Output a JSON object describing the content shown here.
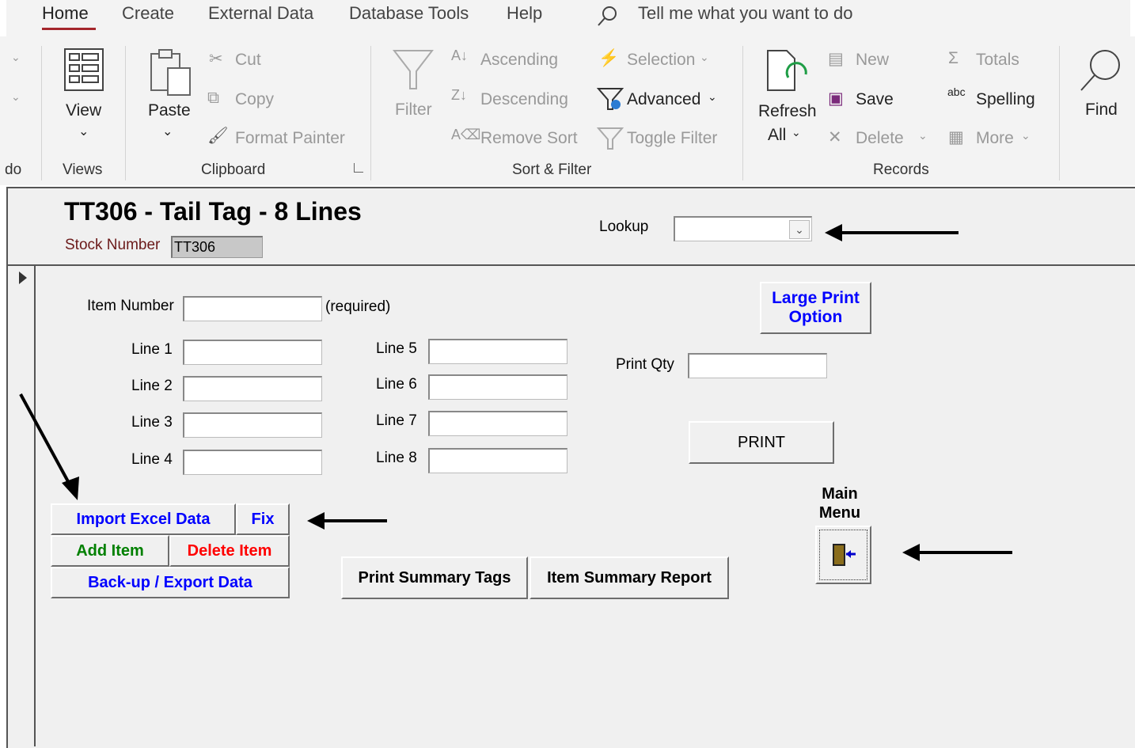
{
  "menu": {
    "tabs": [
      "Home",
      "Create",
      "External Data",
      "Database Tools",
      "Help"
    ],
    "tell_me": "Tell me what you want to do"
  },
  "ribbon": {
    "partial_group": "do",
    "views": {
      "view_label": "View",
      "group_label": "Views"
    },
    "clipboard": {
      "paste": "Paste",
      "cut": "Cut",
      "copy": "Copy",
      "format_painter": "Format Painter",
      "group_label": "Clipboard"
    },
    "sort_filter": {
      "filter": "Filter",
      "ascending": "Ascending",
      "descending": "Descending",
      "remove_sort": "Remove Sort",
      "selection": "Selection",
      "advanced": "Advanced",
      "toggle_filter": "Toggle Filter",
      "group_label": "Sort & Filter"
    },
    "records": {
      "refresh": "Refresh",
      "refresh_all": "All",
      "new": "New",
      "save": "Save",
      "delete": "Delete",
      "totals": "Totals",
      "spelling": "Spelling",
      "more": "More",
      "group_label": "Records"
    },
    "find": {
      "label": "Find"
    }
  },
  "form": {
    "title": "TT306 - Tail Tag - 8 Lines",
    "stock_number_label": "Stock Number",
    "stock_number_value": "TT306",
    "lookup_label": "Lookup",
    "lookup_value": "",
    "item_number_label": "Item Number",
    "required_note": "(required)",
    "lines": [
      "Line 1",
      "Line 2",
      "Line 3",
      "Line 4",
      "Line 5",
      "Line 6",
      "Line 7",
      "Line 8"
    ],
    "print_qty_label": "Print Qty",
    "large_print_option": "Large Print Option",
    "print_button": "PRINT",
    "main_menu_label": "Main Menu",
    "import_excel": "Import Excel Data",
    "fix": "Fix",
    "add_item": "Add Item",
    "delete_item": "Delete Item",
    "backup_export": "Back-up / Export Data",
    "print_summary_tags": "Print Summary Tags",
    "item_summary_report": "Item Summary Report"
  },
  "colors": {
    "blue_button_text": "#0000ff",
    "green_button_text": "#008000",
    "red_button_text": "#ff0000",
    "accent": "#a4262c"
  }
}
